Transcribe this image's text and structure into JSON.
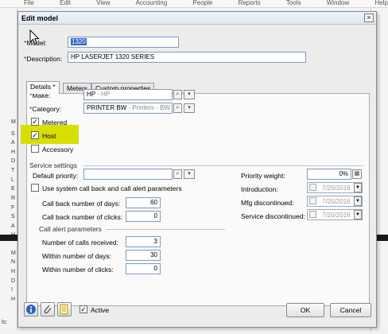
{
  "dialog": {
    "title": "Edit model",
    "close_glyph": "×"
  },
  "background_app": {
    "menu_items": [
      "File",
      "Edit",
      "View",
      "Accounting",
      "People",
      "Reports",
      "Tools",
      "Window",
      "Help"
    ],
    "left_letters": [
      "M",
      "S",
      "A",
      "H",
      "D",
      "T",
      "L",
      "E",
      "R",
      "F",
      "S",
      "A",
      "H",
      "M",
      "N",
      "H",
      "D",
      "I",
      "H"
    ],
    "status_label": "ls:"
  },
  "header_fields": {
    "model_label": "Model:",
    "model_value": "1320",
    "description_label": "Description:",
    "description_value": "HP LASERJET 1320 SERIES"
  },
  "tabs": [
    {
      "label": "Details *",
      "active": true
    },
    {
      "label": "Meters",
      "active": false
    },
    {
      "label": "Custom properties",
      "active": false
    }
  ],
  "details": {
    "make_label": "Make:",
    "make_value": "HP",
    "make_hint": " - HP",
    "category_label": "Category:",
    "category_value": "PRINTER BW",
    "category_hint": " - Printers - BW (Pr",
    "metered_label": "Metered",
    "host_label": "Host",
    "accessory_label": "Accessory",
    "metered_checked": true,
    "host_checked": true,
    "accessory_checked": false
  },
  "service_settings": {
    "section_label": "Service settings",
    "default_priority_label": "Default priority:",
    "default_priority_value": "",
    "use_system_label": "Use system call back and call alert parameters",
    "callback_days_label": "Call back number of days:",
    "callback_days_value": "60",
    "callback_clicks_label": "Call back number of clicks:",
    "callback_clicks_value": "0",
    "priority_weight_label": "Priority weight:",
    "priority_weight_value": "0%",
    "introduction_label": "Introduction:",
    "introduction_value": "7/20/2016",
    "mfg_discontinued_label": "Mfg discontinued:",
    "mfg_discontinued_value": "7/20/2016",
    "service_discontinued_label": "Service discontinued:",
    "service_discontinued_value": "7/20/2016"
  },
  "call_alert": {
    "section_label": "Call alert parameters",
    "calls_received_label": "Number of calls received:",
    "calls_received_value": "3",
    "within_days_label": "Within number of days:",
    "within_days_value": "30",
    "within_clicks_label": "Within number of clicks:",
    "within_clicks_value": "0"
  },
  "footer": {
    "active_label": "Active",
    "active_checked": true,
    "ok_label": "OK",
    "cancel_label": "Cancel"
  },
  "icons": {
    "info": "info-icon",
    "attach": "paperclip-icon",
    "notes": "notes-icon"
  },
  "colors": {
    "highlight": "#d7de00",
    "required": "#c00000",
    "selection": "#316ac5"
  }
}
